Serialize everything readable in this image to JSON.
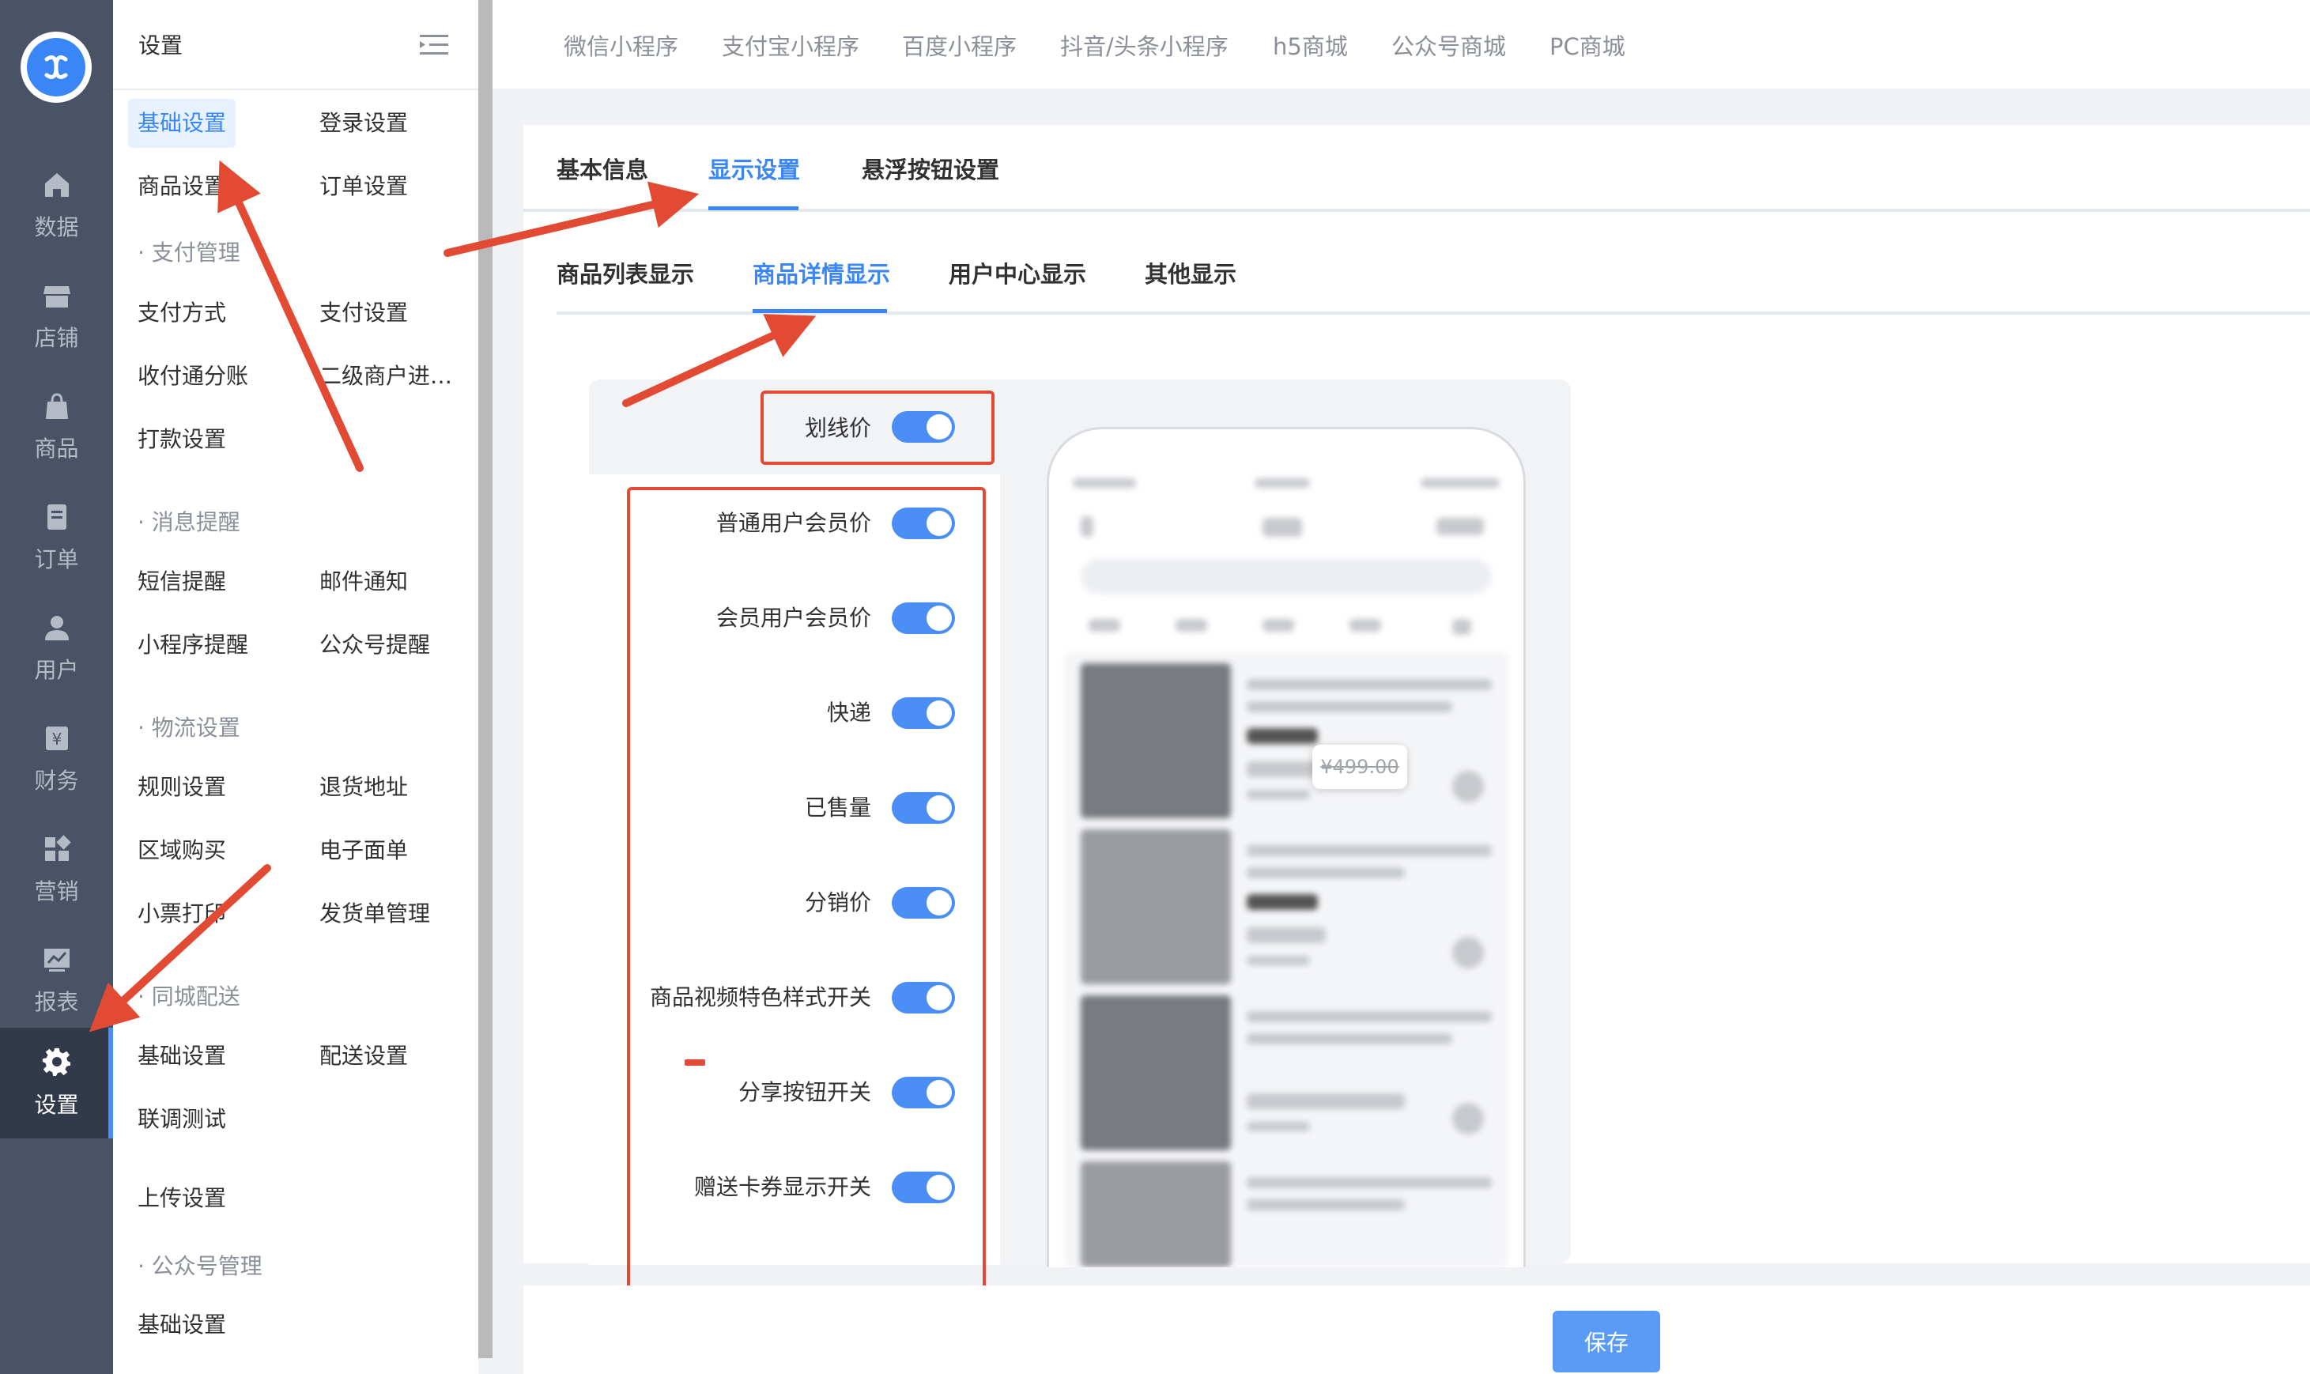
{
  "rail": {
    "items": [
      {
        "label": "数据",
        "icon": "home-icon"
      },
      {
        "label": "店铺",
        "icon": "store-icon"
      },
      {
        "label": "商品",
        "icon": "bag-icon"
      },
      {
        "label": "订单",
        "icon": "order-icon"
      },
      {
        "label": "用户",
        "icon": "user-icon"
      },
      {
        "label": "财务",
        "icon": "finance-icon"
      },
      {
        "label": "营销",
        "icon": "marketing-icon"
      },
      {
        "label": "报表",
        "icon": "report-icon"
      },
      {
        "label": "设置",
        "icon": "gear-icon",
        "active": true
      }
    ]
  },
  "menu": {
    "title": "设置",
    "items": {
      "basic": "基础设置",
      "login": "登录设置",
      "goods": "商品设置",
      "order": "订单设置",
      "pay_group": "· 支付管理",
      "pay_method": "支付方式",
      "pay_setting": "支付设置",
      "split": "收付通分账",
      "sub_merchant": "二级商户进…",
      "payout": "打款设置",
      "msg_group": "· 消息提醒",
      "sms": "短信提醒",
      "email": "邮件通知",
      "mini_remind": "小程序提醒",
      "mp_remind": "公众号提醒",
      "logistics_group": "· 物流设置",
      "rule": "规则设置",
      "return_addr": "退货地址",
      "region": "区域购买",
      "waybill": "电子面单",
      "receipt": "小票打印",
      "shipping": "发货单管理",
      "city_group": "· 同城配送",
      "city_basic": "基础设置",
      "delivery": "配送设置",
      "debug": "联调测试",
      "upload": "上传设置",
      "mp_group": "· 公众号管理",
      "mp_basic": "基础设置"
    }
  },
  "top_tabs": [
    "微信小程序",
    "支付宝小程序",
    "百度小程序",
    "抖音/头条小程序",
    "h5商城",
    "公众号商城",
    "PC商城"
  ],
  "tabs_level1": [
    "基本信息",
    "显示设置",
    "悬浮按钮设置"
  ],
  "tabs_level2": [
    "商品列表显示",
    "商品详情显示",
    "用户中心显示",
    "其他显示"
  ],
  "options": [
    {
      "label": "划线价",
      "on": true
    },
    {
      "label": "普通用户会员价",
      "on": true
    },
    {
      "label": "会员用户会员价",
      "on": true
    },
    {
      "label": "快递",
      "on": true
    },
    {
      "label": "已售量",
      "on": true
    },
    {
      "label": "分销价",
      "on": true
    },
    {
      "label": "商品视频特色样式开关",
      "on": true
    },
    {
      "label": "分享按钮开关",
      "on": true
    },
    {
      "label": "赠送卡券显示开关",
      "on": true
    }
  ],
  "preview": {
    "price_tip": "¥499.00"
  },
  "save_label": "保存",
  "colors": {
    "accent": "#3b86f7",
    "rail": "#4a5366",
    "annotation": "#e24a33",
    "toggle": "#4a8ef5"
  }
}
